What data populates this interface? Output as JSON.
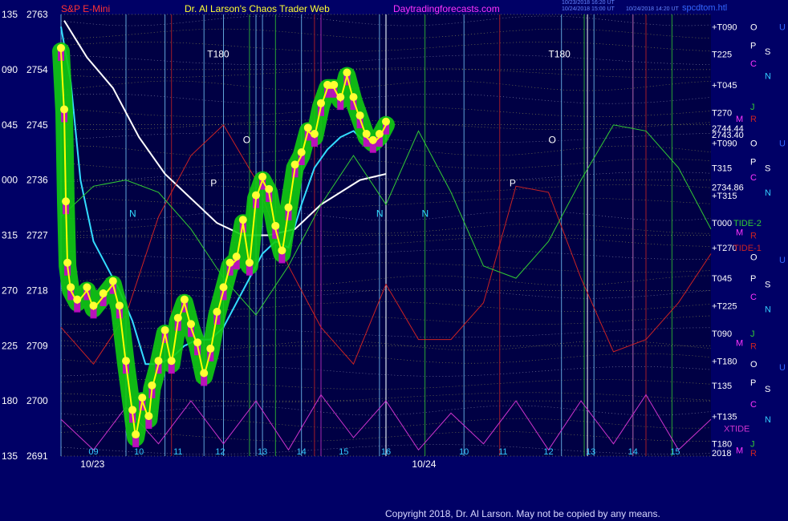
{
  "header": {
    "symbol": "S&P E-Mini",
    "title": "Dr. Al Larson's Chaos Trader Web",
    "site": "Daytradingforecasts.com",
    "stamp1": "10/23/2018 16:20 UT",
    "stamp2": "10/24/2018 15:00 UT",
    "stamp3": "10/24/2018 14:20 UT",
    "page": "spcdtom.htl"
  },
  "copyright": "Copyright 2018, Dr. Al Larson. May not be copied by any means.",
  "colors": {
    "background": "#000066",
    "price": "#ffff00",
    "bar": "#cc00cc",
    "glow": "#11cc11",
    "dots": "#ffff33",
    "ma_fast": "#ffff66",
    "ma_mid": "#33ddff",
    "ma_slow": "#ffffff",
    "tide1": "#cc2222",
    "tide2": "#33cc33",
    "xtide": "#cc33cc"
  },
  "chart_data": {
    "type": "line",
    "y_axis": {
      "range": [
        2691,
        2763
      ],
      "ticks": [
        2763,
        2754,
        2745,
        2736,
        2727,
        2718,
        2709,
        2700,
        2691
      ],
      "angle_labels": [
        "135",
        "090",
        "045",
        "000",
        "315",
        "270",
        "225",
        "180",
        "135"
      ]
    },
    "x_axis": {
      "range": [
        0,
        20
      ],
      "date_labels": [
        {
          "x": 0.6,
          "label": "10/23"
        },
        {
          "x": 10.8,
          "label": "10/24"
        }
      ],
      "hour_labels": [
        {
          "x": 1.0,
          "label": "09"
        },
        {
          "x": 2.4,
          "label": "10"
        },
        {
          "x": 3.6,
          "label": "11"
        },
        {
          "x": 4.9,
          "label": "12"
        },
        {
          "x": 6.2,
          "label": "13"
        },
        {
          "x": 7.4,
          "label": "14"
        },
        {
          "x": 8.7,
          "label": "15"
        },
        {
          "x": 10.0,
          "label": "16"
        },
        {
          "x": 12.4,
          "label": "10"
        },
        {
          "x": 13.6,
          "label": "11"
        },
        {
          "x": 15.0,
          "label": "12"
        },
        {
          "x": 16.3,
          "label": "13"
        },
        {
          "x": 17.6,
          "label": "14"
        },
        {
          "x": 18.9,
          "label": "15"
        }
      ]
    },
    "vertical_lines": {
      "lightblue": [
        0.0,
        2.0,
        3.2,
        4.4,
        5.0,
        6.0,
        6.2,
        7.4,
        9.8,
        10.0,
        12.4,
        15.4,
        16.4
      ],
      "green": [
        5.8,
        6.6,
        11.2,
        16.1,
        17.6,
        18.8
      ],
      "red": [
        3.4,
        7.8,
        13.5,
        18.0
      ],
      "magenta": [
        8.0,
        17.6
      ],
      "white": [
        10.0,
        16.2
      ]
    },
    "series": [
      {
        "name": "price",
        "x": [
          0.0,
          0.1,
          0.15,
          0.2,
          0.3,
          0.5,
          0.8,
          1.0,
          1.3,
          1.6,
          1.8,
          2.0,
          2.2,
          2.3,
          2.5,
          2.7,
          2.8,
          3.0,
          3.2,
          3.4,
          3.6,
          3.8,
          4.0,
          4.2,
          4.4,
          4.6,
          4.8,
          5.0,
          5.2,
          5.4,
          5.6,
          5.8,
          6.0,
          6.2,
          6.4,
          6.6,
          6.8,
          7.0,
          7.2,
          7.4,
          7.6,
          7.8,
          8.0,
          8.2,
          8.4,
          8.6,
          8.8,
          9.0,
          9.2,
          9.4,
          9.6,
          9.8,
          10.0
        ],
        "y": [
          2757,
          2747,
          2732,
          2722,
          2718,
          2716,
          2718,
          2715,
          2717,
          2719,
          2715,
          2706,
          2698,
          2694,
          2700,
          2697,
          2702,
          2706,
          2711,
          2706,
          2713,
          2716,
          2712,
          2709,
          2704,
          2708,
          2714,
          2718,
          2722,
          2723,
          2729,
          2722,
          2733,
          2736,
          2734,
          2728,
          2724,
          2731,
          2738,
          2740,
          2744,
          2743,
          2748,
          2751,
          2751,
          2749,
          2753,
          2749,
          2746,
          2743,
          2742,
          2743,
          2745
        ]
      },
      {
        "name": "",
        "x": [
          0.0,
          0.3,
          0.6,
          1.0,
          1.4,
          1.8,
          2.2,
          2.6,
          3.0,
          3.4,
          3.8,
          4.2,
          4.6,
          5.0,
          5.4,
          5.8,
          6.2,
          6.6,
          7.0,
          7.4,
          7.8,
          8.2,
          8.6,
          9.0,
          9.4,
          9.8
        ],
        "y": [
          2761,
          2752,
          2736,
          2726,
          2722,
          2718,
          2713,
          2706,
          2706,
          2707,
          2709,
          2710,
          2710,
          2712,
          2716,
          2720,
          2724,
          2726,
          2725,
          2732,
          2738,
          2741,
          2743,
          2744,
          2742,
          2743
        ]
      },
      {
        "name": "",
        "x": [
          0.1,
          0.8,
          1.6,
          2.4,
          3.2,
          4.0,
          4.8,
          5.6,
          6.4,
          7.2,
          8.0,
          8.6,
          9.2,
          10.0
        ],
        "y": [
          2762,
          2756,
          2751,
          2743,
          2737,
          2733,
          2729,
          2727,
          2727,
          2728,
          2732,
          2734,
          2736,
          2737
        ]
      },
      {
        "name": "TIDE-1",
        "x": [
          0,
          1,
          2,
          3,
          4,
          5,
          6,
          7,
          8,
          9,
          10,
          11,
          12,
          13,
          14,
          15,
          16,
          17,
          18,
          19,
          20
        ],
        "y": [
          2712,
          2706,
          2714,
          2730,
          2740,
          2745,
          2736,
          2722,
          2712,
          2706,
          2719,
          2710,
          2710,
          2716,
          2735,
          2734,
          2720,
          2708,
          2710,
          2716,
          2724
        ]
      },
      {
        "name": "TIDE-2",
        "x": [
          0,
          1,
          2,
          3,
          4,
          5,
          6,
          7,
          8,
          9,
          10,
          11,
          12,
          13,
          14,
          15,
          16,
          17,
          18,
          19,
          20
        ],
        "y": [
          2730,
          2735,
          2736,
          2734,
          2728,
          2720,
          2714,
          2722,
          2732,
          2740,
          2732,
          2744,
          2734,
          2722,
          2720,
          2726,
          2736,
          2745,
          2744,
          2738,
          2728
        ]
      },
      {
        "name": "XTIDE",
        "x": [
          0,
          1,
          2,
          3,
          4,
          5,
          6,
          7,
          8,
          9,
          10,
          11,
          12,
          13,
          14,
          15,
          16,
          17,
          18,
          19,
          20
        ],
        "y": [
          2697,
          2692,
          2699,
          2693,
          2700,
          2693,
          2700,
          2692,
          2701,
          2694,
          2700,
          2692,
          2698,
          2693,
          2700,
          2692,
          2700,
          2693,
          2701,
          2692,
          2697
        ]
      }
    ],
    "annotations": [
      {
        "x": 4.5,
        "y": 2756,
        "label": "T180",
        "color": "#ffffff"
      },
      {
        "x": 15.0,
        "y": 2756,
        "label": "T180",
        "color": "#ffffff"
      },
      {
        "x": 5.6,
        "y": 2742,
        "label": "O",
        "color": "#ffffff"
      },
      {
        "x": 15.0,
        "y": 2742,
        "label": "O",
        "color": "#ffffff"
      },
      {
        "x": 4.6,
        "y": 2735,
        "label": "P",
        "color": "#ffffff"
      },
      {
        "x": 13.8,
        "y": 2735,
        "label": "P",
        "color": "#ffffff"
      },
      {
        "x": 2.1,
        "y": 2730,
        "label": "N",
        "color": "#33ddff"
      },
      {
        "x": 9.7,
        "y": 2730,
        "label": "N",
        "color": "#33ddff"
      },
      {
        "x": 11.1,
        "y": 2730,
        "label": "N",
        "color": "#33ddff"
      }
    ],
    "right_labels": {
      "angles": [
        {
          "y": 2761,
          "label": "+T090",
          "color": "#ffffff"
        },
        {
          "y": 2756.5,
          "label": "T225",
          "color": "#ffffff"
        },
        {
          "y": 2751.5,
          "label": "+T045",
          "color": "#ffffff"
        },
        {
          "y": 2747,
          "label": "T270",
          "color": "#ffffff"
        },
        {
          "y": 2744.44,
          "label": "2744.44",
          "color": "#ffffff"
        },
        {
          "y": 2743.4,
          "label": "2743.40",
          "color": "#ffffff"
        },
        {
          "y": 2742,
          "label": "+T090",
          "color": "#ffffff"
        },
        {
          "y": 2738,
          "label": "T315",
          "color": "#ffffff"
        },
        {
          "y": 2734.86,
          "label": "2734.86",
          "color": "#ffffff"
        },
        {
          "y": 2733.5,
          "label": "+T315",
          "color": "#ffffff"
        },
        {
          "y": 2729,
          "label": "T000",
          "color": "#ffffff"
        },
        {
          "y": 2729,
          "label": "TIDE-2",
          "color": "#33cc33"
        },
        {
          "y": 2725,
          "label": "+T270",
          "color": "#ffffff"
        },
        {
          "y": 2725,
          "label": "TIDE-1",
          "color": "#cc2222"
        },
        {
          "y": 2720,
          "label": "T045",
          "color": "#ffffff"
        },
        {
          "y": 2715.5,
          "label": "+T225",
          "color": "#ffffff"
        },
        {
          "y": 2711,
          "label": "T090",
          "color": "#ffffff"
        },
        {
          "y": 2706.5,
          "label": "+T180",
          "color": "#ffffff"
        },
        {
          "y": 2702.5,
          "label": "T135",
          "color": "#ffffff"
        },
        {
          "y": 2697.5,
          "label": "+T135",
          "color": "#ffffff"
        },
        {
          "y": 2695.5,
          "label": "XTIDE",
          "color": "#cc33cc"
        },
        {
          "y": 2693,
          "label": "T180",
          "color": "#ffffff"
        },
        {
          "y": 2691.5,
          "label": "2018",
          "color": "#ffffff"
        }
      ],
      "letters": [
        {
          "y": 2761,
          "label": "O",
          "color": "#ffffff",
          "col": 0
        },
        {
          "y": 2761,
          "label": "U",
          "color": "#3366ff",
          "col": 2
        },
        {
          "y": 2758,
          "label": "P",
          "color": "#ffffff",
          "col": 0
        },
        {
          "y": 2757,
          "label": "S",
          "color": "#ffffff",
          "col": 1
        },
        {
          "y": 2755,
          "label": "C",
          "color": "#ff33ff",
          "col": 0
        },
        {
          "y": 2753,
          "label": "N",
          "color": "#33ccff",
          "col": 1
        },
        {
          "y": 2748,
          "label": "J",
          "color": "#33cc33",
          "col": 0
        },
        {
          "y": 2746,
          "label": "M",
          "color": "#ff33ff",
          "col": -1
        },
        {
          "y": 2746,
          "label": "R",
          "color": "#cc2222",
          "col": 0
        },
        {
          "y": 2742,
          "label": "O",
          "color": "#ffffff",
          "col": 0
        },
        {
          "y": 2742,
          "label": "U",
          "color": "#3366ff",
          "col": 2
        },
        {
          "y": 2739,
          "label": "P",
          "color": "#ffffff",
          "col": 0
        },
        {
          "y": 2738,
          "label": "S",
          "color": "#ffffff",
          "col": 1
        },
        {
          "y": 2736.5,
          "label": "C",
          "color": "#ff33ff",
          "col": 0
        },
        {
          "y": 2734,
          "label": "N",
          "color": "#33ccff",
          "col": 1
        },
        {
          "y": 2727.5,
          "label": "M",
          "color": "#ff33ff",
          "col": -1
        },
        {
          "y": 2727,
          "label": "R",
          "color": "#cc2222",
          "col": 0
        },
        {
          "y": 2723.5,
          "label": "O",
          "color": "#ffffff",
          "col": 0
        },
        {
          "y": 2723,
          "label": "U",
          "color": "#3366ff",
          "col": 2
        },
        {
          "y": 2720,
          "label": "P",
          "color": "#ffffff",
          "col": 0
        },
        {
          "y": 2719,
          "label": "S",
          "color": "#ffffff",
          "col": 1
        },
        {
          "y": 2717,
          "label": "C",
          "color": "#ff33ff",
          "col": 0
        },
        {
          "y": 2715,
          "label": "N",
          "color": "#33ccff",
          "col": 1
        },
        {
          "y": 2711,
          "label": "J",
          "color": "#33cc33",
          "col": 0
        },
        {
          "y": 2709.5,
          "label": "M",
          "color": "#ff33ff",
          "col": -1
        },
        {
          "y": 2709,
          "label": "R",
          "color": "#cc2222",
          "col": 0
        },
        {
          "y": 2706,
          "label": "O",
          "color": "#ffffff",
          "col": 0
        },
        {
          "y": 2705.5,
          "label": "U",
          "color": "#3366ff",
          "col": 2
        },
        {
          "y": 2703,
          "label": "P",
          "color": "#ffffff",
          "col": 0
        },
        {
          "y": 2702,
          "label": "S",
          "color": "#ffffff",
          "col": 1
        },
        {
          "y": 2699.5,
          "label": "C",
          "color": "#ff33ff",
          "col": 0
        },
        {
          "y": 2697,
          "label": "N",
          "color": "#33ccff",
          "col": 1
        },
        {
          "y": 2693,
          "label": "J",
          "color": "#33cc33",
          "col": 0
        },
        {
          "y": 2692,
          "label": "M",
          "color": "#ff33ff",
          "col": -1
        },
        {
          "y": 2691.5,
          "label": "R",
          "color": "#cc2222",
          "col": 0
        }
      ]
    }
  }
}
